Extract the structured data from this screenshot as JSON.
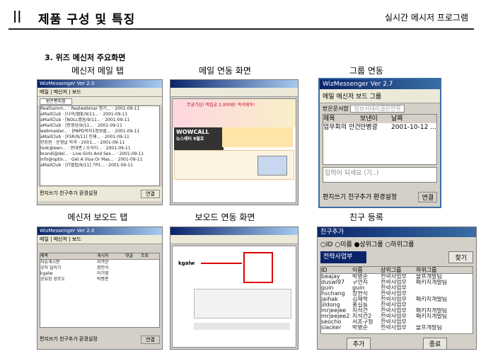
{
  "header": {
    "bars": "||",
    "title": "제품 구성 및 특징",
    "right": "실시간 메시저 프로그램"
  },
  "section_title": "3. 위즈 메신저 주요화면",
  "captions": [
    "메신저 메일 탭",
    "메일 연동 화면",
    "그룹 연동",
    "메신저 보오드 탭",
    "보오드 연동 화면",
    "친구 등록"
  ],
  "small_window": {
    "title": "WizMessenger Ver 2.0",
    "tabs": [
      "메일",
      "메신저",
      "보드"
    ],
    "filter": "받은편지함",
    "mail_rows": [
      [
        "RealSamm...",
        "Realwebmar 정기...",
        "2001-09-11"
      ],
      [
        "aMailClub",
        "[나의/웹툰/9/11...",
        "2001-09-11"
      ],
      [
        "aMailClub",
        "[NOLL했음/9/11...",
        "2001-09-11"
      ],
      [
        "aMailClub",
        "[동영상/9/11...",
        "2001-09-11"
      ],
      [
        "webmaster...",
        "[PAPD의자1정보를...",
        "2001-09-11"
      ],
      [
        "aMailClub",
        "[FSR/9/11] 인재...",
        "2001-09-11"
      ],
      [
        "한승현",
        "운영날 학과 - 2001...",
        "2001-09-11"
      ],
      [
        "look@ewn...",
        "한대면 / 소식이...",
        "2001-09-11"
      ],
      [
        "brandi@del...",
        "Live Girls And Sex...",
        "2001-09-11"
      ],
      [
        "info@optin...",
        "Get A Visa Or Mas...",
        "2001-09-11"
      ],
      [
        "aMailClub",
        "[IT클럽/9/11] 기타...",
        "2001-09-11"
      ]
    ],
    "footer": [
      "편지쓰기",
      "친구추가",
      "환경설정"
    ],
    "status": "연결"
  },
  "board_window": {
    "title": "WizMessenger Ver 2.0",
    "tabs": [
      "메일",
      "메신저",
      "보드"
    ],
    "columns": [
      "제목",
      "게시자",
      "댓글",
      "조회"
    ],
    "rows": [
      [
        "자유게시판",
        "지역관"
      ],
      [
        "공지 알리기",
        "정민식"
      ],
      [
        "kgalw",
        "이기영"
      ],
      [
        "공유된 양조도",
        "박병준"
      ]
    ],
    "footer": [
      "편지쓰기",
      "친구추가",
      "환경설정"
    ],
    "status": "연결"
  },
  "group_window": {
    "title": "WizMessenger Ver 2.7",
    "tabs": [
      "메일",
      "메신저",
      "보드",
      "그룹"
    ],
    "filter_label": "받은문서함",
    "filter_value": "정보서대리결문연락",
    "columns": [
      "제목",
      "보낸이",
      "날짜"
    ],
    "row": [
      "업무회의 안건",
      "안병광",
      "2001-10-12 ..."
    ],
    "hint": "입력이 되세요 (기..)",
    "footer": [
      "편지쓰기",
      "친구추가",
      "환경설정"
    ],
    "status": "연결"
  },
  "friend_window": {
    "title": "친구추가",
    "options": [
      "ID",
      "이름",
      "상위그룹",
      "하위그룹"
    ],
    "group_value": "전략사업부",
    "search_button": "찾기",
    "columns": [
      "ID",
      "이름",
      "상위그룹",
      "하위그룹"
    ],
    "rows": [
      [
        "beajay",
        "박병준",
        "전략사업부",
        "몰프개발팀"
      ],
      [
        "duswl97",
        "구연지",
        "전략사업부",
        "패키지개발팀"
      ],
      [
        "guin",
        "guin",
        "전략사업부",
        ""
      ],
      [
        "hschang",
        "장현식",
        "전략사업부",
        ""
      ],
      [
        "jaihak",
        "김재학",
        "전략사업부",
        "패키지개발팀"
      ],
      [
        "jildong",
        "홍길동",
        "전략사업부",
        ""
      ],
      [
        "mrjeejee",
        "지석건",
        "전략사업부",
        "패키지개발팀"
      ],
      [
        "mrjeejee2",
        "지석건2",
        "전략사업부",
        "패키지개발팀"
      ],
      [
        "seocho",
        "서초구청",
        "전략사업부",
        ""
      ],
      [
        "slacker",
        "박병준",
        "전략사업부",
        "몰프개발팀"
      ]
    ],
    "add_button": "추가",
    "close_button": "종료"
  },
  "mail_web": {
    "brand": "WOWCALL",
    "brand_sub": "뉴스레터 9월호",
    "promo": "무궁기심! 적립금 2,000원! 즉석획득!"
  },
  "board_web": {
    "item": "kgalw"
  }
}
